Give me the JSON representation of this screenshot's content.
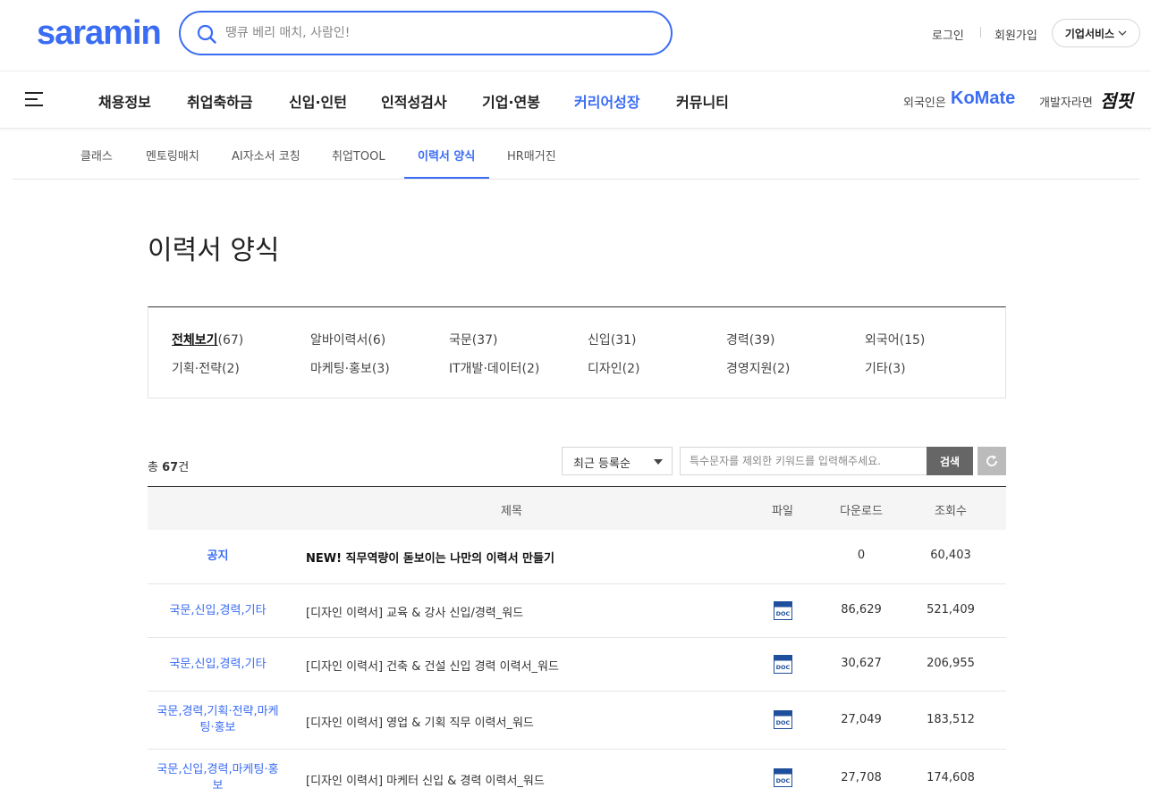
{
  "header": {
    "logo": "saramin",
    "search_placeholder": "땡큐 베리 매치, 사람인!",
    "login": "로그인",
    "signup": "회원가입",
    "biz_service": "기업서비스"
  },
  "gnb": {
    "items": [
      {
        "label": "채용정보"
      },
      {
        "label": "취업축하금"
      },
      {
        "label": "신입·인턴"
      },
      {
        "label": "인적성검사"
      },
      {
        "label": "기업·연봉"
      },
      {
        "label": "커리어성장",
        "active": true
      },
      {
        "label": "커뮤니티"
      }
    ],
    "foreigner_label": "외국인은",
    "komate": "KoMate",
    "developer_label": "개발자라면",
    "jumpit": "점핏"
  },
  "subnav": {
    "items": [
      {
        "label": "클래스"
      },
      {
        "label": "멘토링매치"
      },
      {
        "label": "AI자소서 코칭"
      },
      {
        "label": "취업TOOL"
      },
      {
        "label": "이력서 양식",
        "active": true
      },
      {
        "label": "HR매거진"
      }
    ]
  },
  "page_title": "이력서 양식",
  "categories": [
    {
      "name": "전체보기",
      "count": "(67)",
      "selected": true
    },
    {
      "name": "알바이력서",
      "count": "(6)"
    },
    {
      "name": "국문",
      "count": "(37)"
    },
    {
      "name": "신입",
      "count": "(31)"
    },
    {
      "name": "경력",
      "count": "(39)"
    },
    {
      "name": "외국어",
      "count": "(15)"
    },
    {
      "name": "기획·전략",
      "count": "(2)"
    },
    {
      "name": "마케팅·홍보",
      "count": "(3)"
    },
    {
      "name": "IT개발·데이터",
      "count": "(2)"
    },
    {
      "name": "디자인",
      "count": "(2)"
    },
    {
      "name": "경영지원",
      "count": "(2)"
    },
    {
      "name": "기타",
      "count": "(3)"
    }
  ],
  "toolbar": {
    "total_prefix": "총",
    "total_count": "67",
    "total_suffix": "건",
    "sort_value": "최근 등록순",
    "keyword_placeholder": "특수문자를 제외한 키워드를 입력해주세요.",
    "search_label": "검색"
  },
  "table": {
    "headers": {
      "title": "제목",
      "file": "파일",
      "downloads": "다운로드",
      "views": "조회수"
    },
    "rows": [
      {
        "category": "공지",
        "title": "NEW! 직무역량이 돋보이는 나만의 이력서 만들기",
        "notice": true,
        "file": "",
        "downloads": "0",
        "views": "60,403"
      },
      {
        "category": "국문,신입,경력,기타",
        "title": "[디자인 이력서] 교육 & 강사 신입/경력_워드",
        "file": "doc",
        "downloads": "86,629",
        "views": "521,409"
      },
      {
        "category": "국문,신입,경력,기타",
        "title": "[디자인 이력서] 건축 & 건설 신입 경력 이력서_워드",
        "file": "doc",
        "downloads": "30,627",
        "views": "206,955"
      },
      {
        "category": "국문,경력,기획·전략,마케팅·홍보",
        "title": "[디자인 이력서] 영업 & 기획 직무 이력서_워드",
        "file": "doc",
        "downloads": "27,049",
        "views": "183,512"
      },
      {
        "category": "국문,신입,경력,마케팅·홍보",
        "title": "[디자인 이력서] 마케터 신입 & 경력 이력서_워드",
        "file": "doc",
        "downloads": "27,708",
        "views": "174,608"
      }
    ]
  },
  "colors": {
    "brand": "#3a6cf4"
  }
}
